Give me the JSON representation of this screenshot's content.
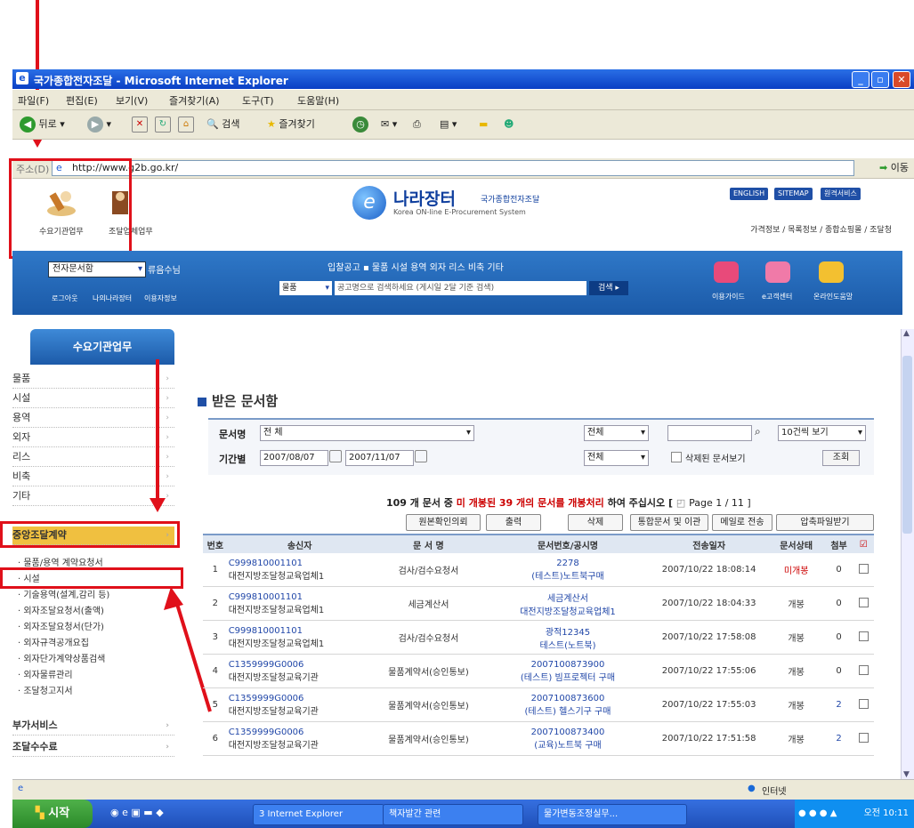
{
  "window": {
    "title": "국가종합전자조달 - Microsoft Internet Explorer",
    "menu": [
      "파일(F)",
      "편집(E)",
      "보기(V)",
      "즐겨찾기(A)",
      "도구(T)",
      "도움말(H)"
    ],
    "toolbar": {
      "back": "뒤로",
      "search": "검색",
      "favorites": "즐겨찾기"
    },
    "address_label": "주소(D)",
    "url": "http://www.g2b.go.kr/",
    "go": "이동"
  },
  "header": {
    "icon1_label": "수요기관업무",
    "icon2_label": "조달업체업무",
    "logo_title": "나라장터",
    "logo_sub": "국가종합전자조달",
    "logo_en": "Korea ON-line E-Procurement System",
    "top_buttons": [
      "ENGLISH",
      "SITEMAP",
      "원격서비스"
    ],
    "links": "가격정보 / 목록정보 / 종합쇼핑몰 / 조달청"
  },
  "nav": {
    "doc_select": "전자문서함",
    "ryu": "류음수님",
    "small_links": [
      "로그아웃",
      "나의나라장터",
      "이용자정보"
    ],
    "menu": "입찰공고 ▪ 물품 시설 용역 외자 리스 비축 기타",
    "search_select": "물품",
    "search_placeholder": "공고명으로 검색하세요 (게시일 2달 기준 검색)",
    "search_button": "검색 ▸",
    "right_icons": [
      "이용가이드",
      "e고객센터",
      "온라인도움말"
    ]
  },
  "sidebar": {
    "title": "수요기관업무",
    "items": [
      "물품",
      "시설",
      "용역",
      "외자",
      "리스",
      "비축",
      "기타",
      "중앙조달계약"
    ],
    "subitems": [
      "· 물품/용역 계약요청서",
      "· 시설",
      "· 기술용역(설계,감리 등)",
      "· 외자조달요청서(출액)",
      "· 외자조달요청서(단가)",
      "· 외자규격공개요집",
      "· 외자단가계약상품검색",
      "· 외자물류관리",
      "· 조달청고지서"
    ],
    "bottom": [
      "부가서비스",
      "조달수수료"
    ]
  },
  "main": {
    "title": "받은 문서함",
    "filter": {
      "doc_label": "문서명",
      "doc_value": "전 체",
      "period_label": "기간별",
      "date_from": "2007/08/07",
      "date_to": "2007/11/07",
      "all1": "전체",
      "all2": "전체",
      "view": "10건씩 보기",
      "deleted": "삭제된 문서보기",
      "query": "조회"
    },
    "count": {
      "pre": "109 개 문서 중 ",
      "red": "미 개봉된 39 개의 문서를 개봉처리",
      "post": " 하여 주십시오 [ ",
      "page": "Page 1 / 11 ]"
    },
    "actions": [
      "원본확인의뢰",
      "출력",
      "삭제",
      "통합문서 및 이관",
      "메일로 전송",
      "압축파일받기"
    ],
    "columns": [
      "번호",
      "송신자",
      "문 서 명",
      "문서번호/공시명",
      "전송일자",
      "문서상태",
      "첨부",
      "☑"
    ],
    "rows": [
      {
        "no": "1",
        "code": "C999810001101",
        "org": "대전지방조달청교육업체1",
        "doc": "검사/검수요청서",
        "num": "2278",
        "name": "(테스트)노트북구매",
        "date": "2007/10/22 18:08:14",
        "status": "미개봉",
        "att": "0"
      },
      {
        "no": "2",
        "code": "C999810001101",
        "org": "대전지방조달청교육업체1",
        "doc": "세금계산서",
        "num": "세금계산서",
        "name": "대전지방조달청교육업체1",
        "date": "2007/10/22 18:04:33",
        "status": "개봉",
        "att": "0"
      },
      {
        "no": "3",
        "code": "C999810001101",
        "org": "대전지방조달청교육업체1",
        "doc": "검사/검수요청서",
        "num": "광적12345",
        "name": "테스트(노트북)",
        "date": "2007/10/22 17:58:08",
        "status": "개봉",
        "att": "0"
      },
      {
        "no": "4",
        "code": "C1359999G0006",
        "org": "대전지방조달청교육기관",
        "doc": "물품계약서(승인통보)",
        "num": "2007100873900",
        "name": "(테스트) 빔프로젝터 구매",
        "date": "2007/10/22 17:55:06",
        "status": "개봉",
        "att": "0"
      },
      {
        "no": "5",
        "code": "C1359999G0006",
        "org": "대전지방조달청교육기관",
        "doc": "물품계약서(승인통보)",
        "num": "2007100873600",
        "name": "(테스트) 헬스기구 구매",
        "date": "2007/10/22 17:55:03",
        "status": "개봉",
        "att": "2"
      },
      {
        "no": "6",
        "code": "C1359999G0006",
        "org": "대전지방조달청교육기관",
        "doc": "물품계약서(승인통보)",
        "num": "2007100873400",
        "name": "(교육)노트북 구매",
        "date": "2007/10/22 17:51:58",
        "status": "개봉",
        "att": "2"
      }
    ]
  },
  "status": {
    "zone": "인터넷"
  },
  "taskbar": {
    "start": "시작",
    "tasks": [
      "3 Internet Explorer",
      "책자발간 관련",
      "물가변동조정실무..."
    ],
    "clock": "오전 10:11"
  },
  "colors": {
    "annotation": "#e0101a",
    "brand_blue": "#1f4fa6",
    "unread": "#cc0000"
  }
}
